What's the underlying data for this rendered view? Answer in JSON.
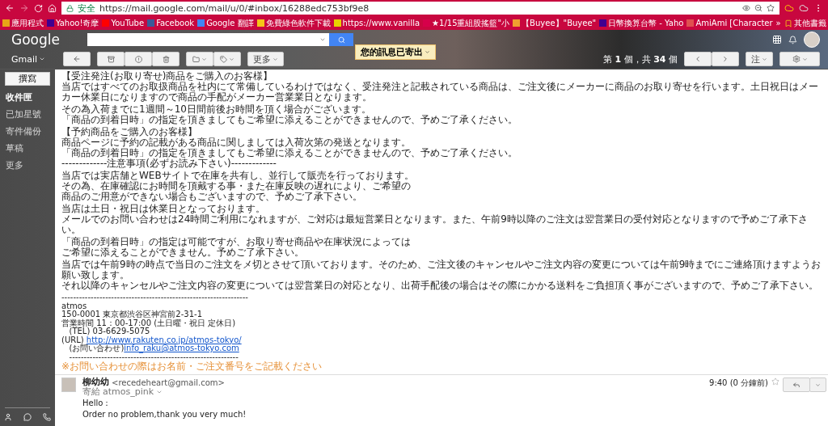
{
  "browser": {
    "secure_label": "安全",
    "url": "https://mail.google.com/mail/u/0/#inbox/16288edc753bf9e8",
    "bookmarks": [
      {
        "label": "應用程式",
        "color": "#e8a317"
      },
      {
        "label": "Yahoo!奇摩",
        "color": "#400090"
      },
      {
        "label": "YouTube",
        "color": "#ff0000"
      },
      {
        "label": "Facebook",
        "color": "#3b5998"
      },
      {
        "label": "Google 翻譯",
        "color": "#4285f4"
      },
      {
        "label": "免費綠色軟件下載",
        "color": "#f5c518"
      },
      {
        "label": "https://www.vanilla",
        "color": "#e8d000"
      },
      {
        "label": "★1/15重組股搖籃\"小",
        "color": "#d6004a"
      },
      {
        "label": "【Buyee】\"Buyee\"",
        "color": "#f0a030"
      },
      {
        "label": "日幣換算台幣 - Yaho",
        "color": "#400090"
      },
      {
        "label": "AmiAmi [Character",
        "color": "#e05050"
      }
    ],
    "overflow": "»",
    "other_bookmarks": "其他書籤"
  },
  "gmail": {
    "logo": "Google",
    "app_label": "Gmail",
    "compose": "撰寫",
    "nav": [
      {
        "label": "收件匣",
        "selected": true
      },
      {
        "label": "已加星號",
        "selected": false
      },
      {
        "label": "寄件備份",
        "selected": false
      },
      {
        "label": "草稿",
        "selected": false
      },
      {
        "label": "更多",
        "selected": false
      }
    ],
    "more_button": "更多",
    "notice": "您的訊息已寄出",
    "paging": "第 **1** 個，共 **34** 個",
    "input_tools": "注"
  },
  "message": {
    "paragraphs": [
      [
        "【受注発注(お取り寄せ)商品をご購入のお客様】",
        "当店ではすべてのお取扱商品を社内にて常備しているわけではなく、受注発注と記載されている商品は、ご注文後にメーカーに商品のお取り寄せを行います。土日祝日はメーカー休業日になりますので商品の手配がメーカー営業業日となります。"
      ],
      [
        "その為入荷までに1週間～10日間前後お時間を頂く場合がございます。",
        "「商品の到着日時」の指定を頂きましてもご希望に添えることができませんので、予めご了承ください。"
      ],
      [
        "【予約商品をご購入のお客様】",
        "商品ページに予約の記載がある商品に関しましては入荷次第の発送となります。",
        "「商品の到着日時」の指定を頂きましてもご希望に添えることができませんので、予めご了承ください。",
        "-------------注意事項(必ずお読み下さい)-------------"
      ],
      [
        "当店では実店舗とWEBサイトで在庫を共有し、並行して販売を行っております。",
        "その為、在庫確認にお時間を頂戴する事・また在庫反映の遅れにより、ご希望の",
        "商品のご用意ができない場合もございますので、予めご了承下さい。"
      ],
      [
        "当店は土日・祝日は休業日となっております。",
        "メールでのお問い合わせは24時間ご利用になれますが、ご対応は最短営業日となります。また、午前9時以降のご注文は翌営業日の受付対応となりますので予めご了承下さい。"
      ],
      [
        "「商品の到着日時」の指定は可能ですが、お取り寄せ商品や在庫状況によっては",
        "ご希望に添えることができません。予めご了承下さい。"
      ],
      [
        "当店では午前9時の時点で当日のご注文をメ切とさせて頂いております。そのため、ご注文後のキャンセルやご注文内容の変更については午前9時までにご連絡頂けますようお願い致します。",
        "それ以降のキャンセルやご注文内容の変更については翌営業日の対応となり、出荷手配後の場合はその際にかかる送料をご負担頂く事がございますので、予めご了承下さい。"
      ]
    ],
    "signature": [
      {
        "kind": "plain",
        "text": "----------------------------------------------------------------"
      },
      {
        "kind": "plain",
        "text": "atmos"
      },
      {
        "kind": "plain",
        "text": "150-0001 東京都渋谷区神宮前2-31-1"
      },
      {
        "kind": "plain",
        "text": "営業時間 11：00-17:00 (土日曜・祝日 定休日)"
      },
      {
        "kind": "plain",
        "text": "   (TEL) 03-6629-5075"
      },
      {
        "kind": "link",
        "text": "(URL) ",
        "link": "http://www.rakuten.co.jp/atmos-tokyo/"
      },
      {
        "kind": "link",
        "text": "   (お問い合わせ)",
        "link": "info_raku@atmos-tokyo.com"
      },
      {
        "kind": "plain",
        "text": "   ----------------------------------------------------------"
      },
      {
        "kind": "note",
        "text": "※お問い合わせの際はお名前・ご注文番号をご記載ください"
      }
    ]
  },
  "reply": {
    "sender": "柳幼幼",
    "email": "<recedeheart@gmail.com>",
    "to_label": "寄給",
    "to": "atmos_pink",
    "time": "9:40 (0 分鐘前)",
    "starred": false,
    "lines": [
      "Hello：",
      "Order no problem,thank you very much!"
    ]
  }
}
